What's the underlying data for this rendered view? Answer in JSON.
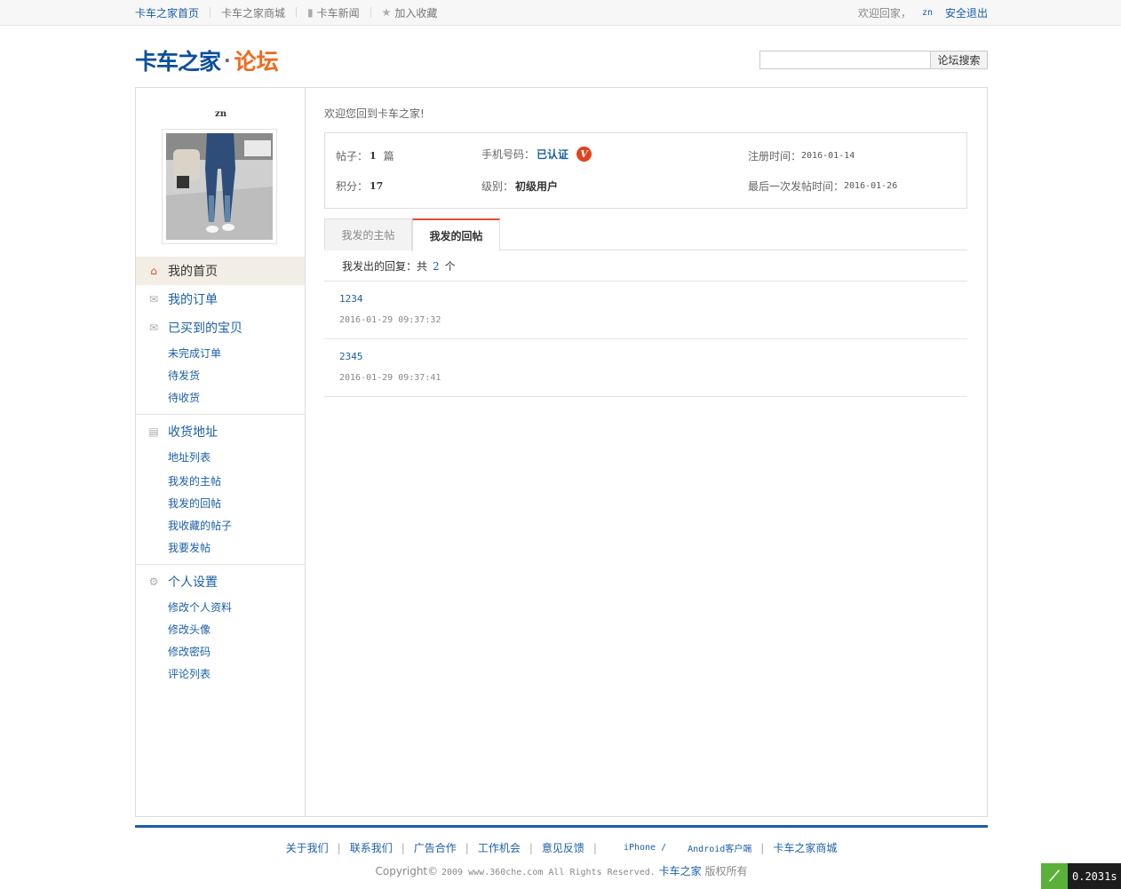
{
  "topbar": {
    "links": [
      "卡车之家首页",
      "卡车之家商城",
      "卡车新闻",
      "加入收藏"
    ],
    "welcome": "欢迎回家，",
    "username": "zn",
    "logout": "安全退出"
  },
  "header": {
    "logo_main": "卡车之家",
    "logo_dot": "·",
    "logo_section": "论坛",
    "search_placeholder": "",
    "search_button": "论坛搜索"
  },
  "sidebar": {
    "username": "zn",
    "home": "我的首页",
    "orders": "我的订单",
    "purchased": "已买到的宝贝",
    "purchased_items": [
      "未完成订单",
      "待发货",
      "待收货"
    ],
    "address": "收货地址",
    "address_items": [
      "地址列表",
      "我发的主帖",
      "我发的回帖",
      "我收藏的帖子",
      "我要发帖"
    ],
    "settings": "个人设置",
    "settings_items": [
      "修改个人资料",
      "修改头像",
      "修改密码",
      "评论列表"
    ]
  },
  "main": {
    "welcome": "欢迎您回到卡车之家!",
    "stats": {
      "posts_label": "帖子：",
      "posts_value": "1",
      "posts_unit": "篇",
      "phone_label": "手机号码：",
      "phone_value": "已认证",
      "verified_badge": "V",
      "reg_label": "注册时间：",
      "reg_value": "2016-01-14",
      "points_label": "积分：",
      "points_value": "17",
      "level_label": "级别：",
      "level_value": "初级用户",
      "last_post_label": "最后一次发帖时间：",
      "last_post_value": "2016-01-26"
    },
    "tabs": [
      "我发的主帖",
      "我发的回帖"
    ],
    "active_tab": "我发的回帖",
    "count_prefix": "我发出的回复：共",
    "count_value": "2",
    "count_suffix": "个",
    "replies": [
      {
        "title": "1234",
        "time": "2016-01-29 09:37:32"
      },
      {
        "title": "2345",
        "time": "2016-01-29 09:37:41"
      }
    ]
  },
  "footer": {
    "links": [
      "关于我们",
      "联系我们",
      "广告合作",
      "工作机会",
      "意见反馈",
      "iPhone /",
      "Android客户端",
      "卡车之家商城"
    ],
    "copyright_prefix": "Copyright©",
    "copyright_mid": "2009 www.360che.com All Rights Reserved.",
    "copyright_brand": "卡车之家",
    "copyright_suffix": "版权所有"
  },
  "timer": {
    "value": "0.2031s"
  },
  "colors": {
    "link": "#1a5fa8",
    "accent": "#e0502a",
    "logo_blue": "#0b4f9e",
    "logo_orange": "#ee6a1d"
  }
}
